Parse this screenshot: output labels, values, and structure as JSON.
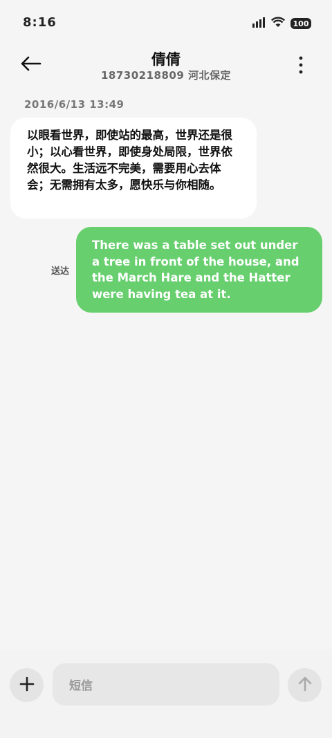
{
  "status_bar": {
    "time": "8:16",
    "battery": "100",
    "icons": [
      "signal-icon",
      "wifi-icon",
      "battery-icon"
    ]
  },
  "header": {
    "contact_name": "倩倩",
    "contact_sub": "18730218809 河北保定",
    "icons": [
      "back-arrow-icon",
      "more-vert-icon"
    ]
  },
  "conversation": {
    "timestamp": "2016/6/13 13:49",
    "incoming_message": "以眼看世界，即使站的最高，世界还是很小；以心看世界，即使身处局限，世界依然很大。生活远不完美，需要用心去体会；无需拥有太多，愿快乐与你相随。",
    "outgoing_message": "There was a table set out under a tree in front of the house, and the March Hare and the Hatter were having tea at it.",
    "outgoing_status": "送达"
  },
  "compose": {
    "placeholder": "短信",
    "icons": [
      "plus-icon",
      "send-arrow-icon"
    ]
  },
  "colors": {
    "background": "#f5f5f5",
    "incoming_bubble": "#ffffff",
    "outgoing_bubble": "#67cf6e",
    "input_background": "#e7e7e7"
  }
}
